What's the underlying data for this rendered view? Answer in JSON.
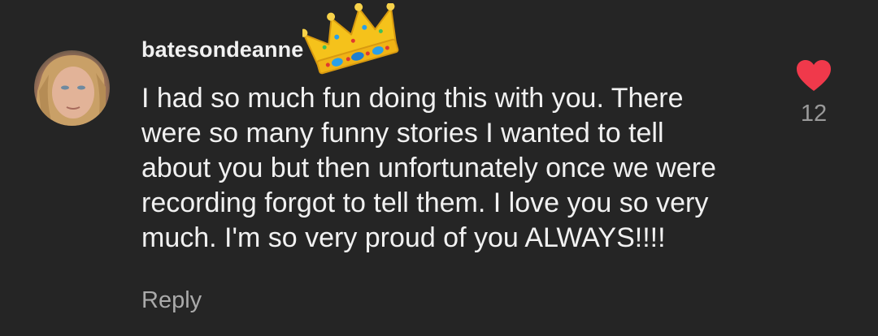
{
  "comment": {
    "author": "batesondeanne",
    "timestamp_partial": "1",
    "body": "I had so much fun doing this with you.  There\nwere so many funny stories I wanted to tell\nabout you but then unfortunately once we were\nrecording forgot to tell them.  I love you so very\nmuch.  I'm so very proud of you ALWAYS!!!!",
    "like_count": "12",
    "reply_label": "Reply",
    "like_icon": "heart-icon",
    "sticker": "crown-sticker"
  },
  "colors": {
    "background": "#252525",
    "text_primary": "#f1f1f1",
    "text_secondary": "#9a9a9a",
    "heart": "#f0394b",
    "crown": "#f5c21b"
  }
}
